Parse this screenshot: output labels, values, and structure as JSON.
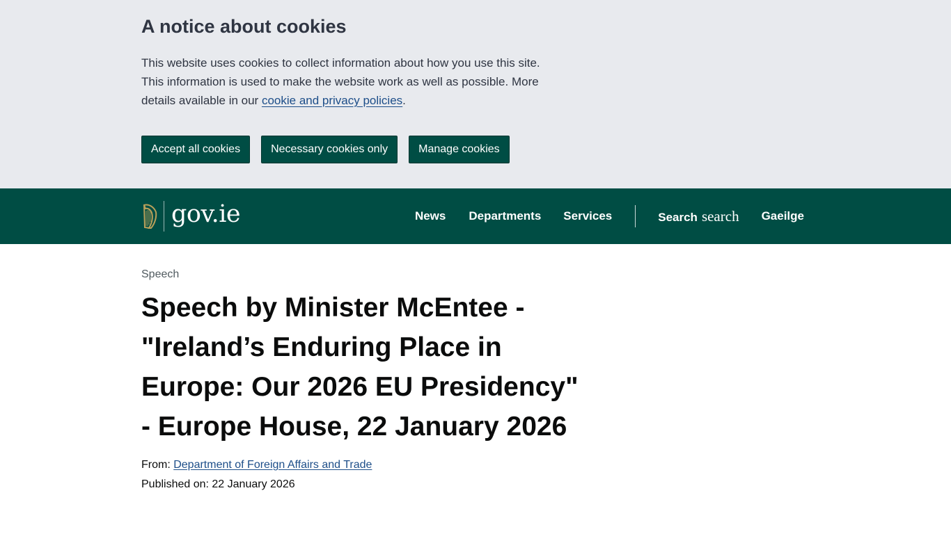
{
  "cookie_banner": {
    "title": "A notice about cookies",
    "text_before_link": "This website uses cookies to collect information about how you use this site. This information is used to make the website work as well as possible. More details available in our ",
    "link_text": "cookie and privacy policies",
    "text_after_link": ".",
    "buttons": {
      "accept_all": "Accept all cookies",
      "necessary_only": "Necessary cookies only",
      "manage": "Manage cookies"
    }
  },
  "header": {
    "logo_text": "gov.ie",
    "nav": {
      "news": "News",
      "departments": "Departments",
      "services": "Services",
      "search": "Search",
      "search_icon_text": "search",
      "language": "Gaeilge"
    }
  },
  "main": {
    "content_type": "Speech",
    "title": "Speech by Minister McEntee - \"Ireland’s Enduring Place in Europe: Our 2026 EU Presidency\" - Europe House, 22 January 2026",
    "from_label": "From: ",
    "from_link": "Department of Foreign Affairs and Trade",
    "published_label": "Published on: ",
    "published_date": "22 January 2026"
  },
  "colors": {
    "brand_green": "#004d44",
    "banner_bg": "#e8eaee",
    "link_blue": "#1d4e89"
  },
  "icons": {
    "logo": "harp-icon"
  }
}
